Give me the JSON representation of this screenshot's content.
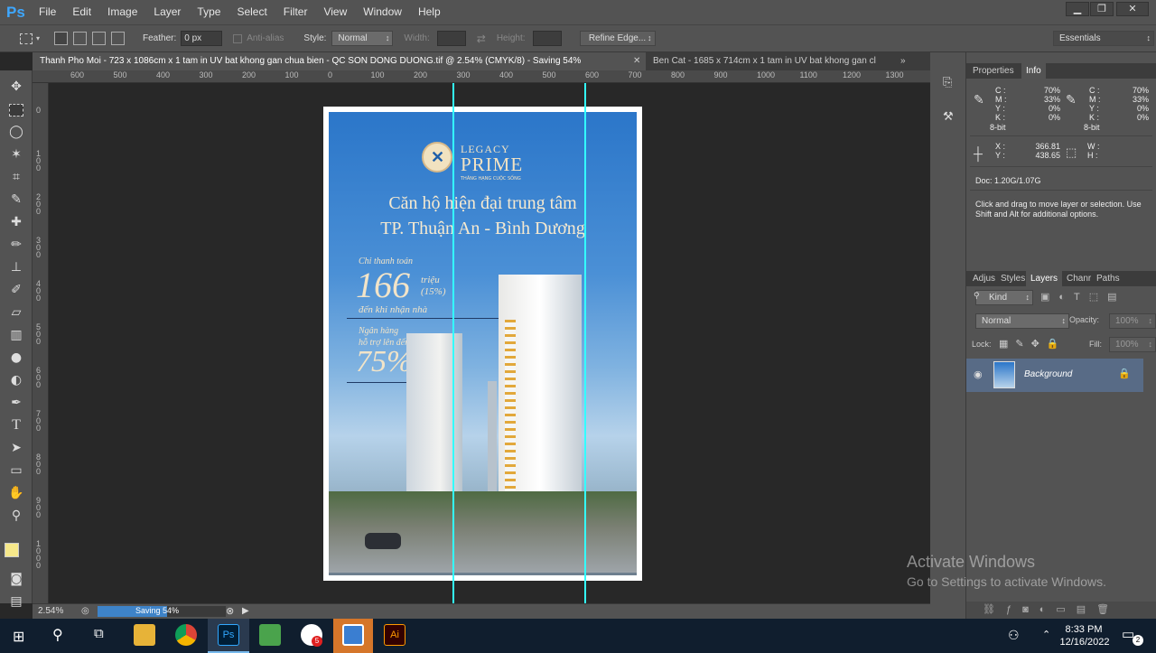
{
  "app": {
    "logo": "Ps"
  },
  "menu": [
    "File",
    "Edit",
    "Image",
    "Layer",
    "Type",
    "Select",
    "Filter",
    "View",
    "Window",
    "Help"
  ],
  "window_controls": {
    "minimize": "▁",
    "restore": "❐",
    "close": "✕"
  },
  "options": {
    "feather_label": "Feather:",
    "feather_value": "0 px",
    "antialias_label": "Anti-alias",
    "style_label": "Style:",
    "style_value": "Normal",
    "width_label": "Width:",
    "height_label": "Height:",
    "refine_edge": "Refine Edge...",
    "workspace": "Essentials"
  },
  "tabs": [
    {
      "label": "Thanh Pho Moi - 723 x 1086cm x 1 tam in UV bat khong gan chua bien - QC SON DONG DUONG.tif @ 2.54% (CMYK/8) - Saving 54%",
      "active": true
    },
    {
      "label": "Ben Cat - 1685 x 714cm x 1 tam in UV bat khong gan cl",
      "active": false
    }
  ],
  "ruler_top": [
    "600",
    "500",
    "400",
    "300",
    "200",
    "100",
    "0",
    "100",
    "200",
    "300",
    "400",
    "500",
    "600",
    "700",
    "800",
    "900",
    "1000",
    "1100",
    "1200",
    "1300"
  ],
  "ruler_left": [
    "0",
    "100",
    "200",
    "300",
    "400",
    "500",
    "600",
    "700",
    "800",
    "900",
    "1000"
  ],
  "document": {
    "brand_small": "LEGACY",
    "brand_big": "PRIME",
    "brand_tag": "THĂNG HẠNG CUỘC SỐNG",
    "headline1": "Căn hộ hiện đại trung tâm",
    "headline2": "TP. Thuận An - Bình Dương",
    "pay_label": "Chỉ thanh toán",
    "pay_value": "166",
    "pay_unit": "triệu",
    "pay_pct": "(15%)",
    "pay_sub": "đến khi nhận nhà",
    "bank_label1": "Ngân hàng",
    "bank_label2": "hỗ trợ lên đến",
    "bank_value": "75%"
  },
  "status": {
    "zoom": "2.54%",
    "progress_label": "Saving 54%",
    "progress": 0.54
  },
  "panels": {
    "top_tabs": [
      "Properties",
      "Info"
    ],
    "info": {
      "c_label": "C :",
      "m_label": "M :",
      "y_label": "Y :",
      "k_label": "K :",
      "c1": "70%",
      "m1": "33%",
      "y1": "0%",
      "k1": "0%",
      "bit1": "8-bit",
      "c2": "70%",
      "m2": "33%",
      "y2": "0%",
      "k2": "0%",
      "bit2": "8-bit",
      "x_label": "X :",
      "y_coord_label": "Y :",
      "x_value": "366.81",
      "y_value": "438.65",
      "w_label": "W :",
      "h_label": "H :",
      "doc": "Doc: 1.20G/1.07G",
      "hint": "Click and drag to move layer or selection. Use Shift and Alt for additional options."
    },
    "layer_tabs": [
      "Adjus",
      "Styles",
      "Layers",
      "Chanr",
      "Paths"
    ],
    "kind": "Kind",
    "blend": "Normal",
    "opacity_label": "Opacity:",
    "opacity_value": "100%",
    "lock_label": "Lock:",
    "fill_label": "Fill:",
    "fill_value": "100%",
    "layer_name": "Background"
  },
  "watermark": {
    "title": "Activate Windows",
    "sub": "Go to Settings to activate Windows."
  },
  "taskbar": {
    "time": "8:33 PM",
    "date": "12/16/2022",
    "notif_count": "2",
    "chrome_badge": "5"
  }
}
